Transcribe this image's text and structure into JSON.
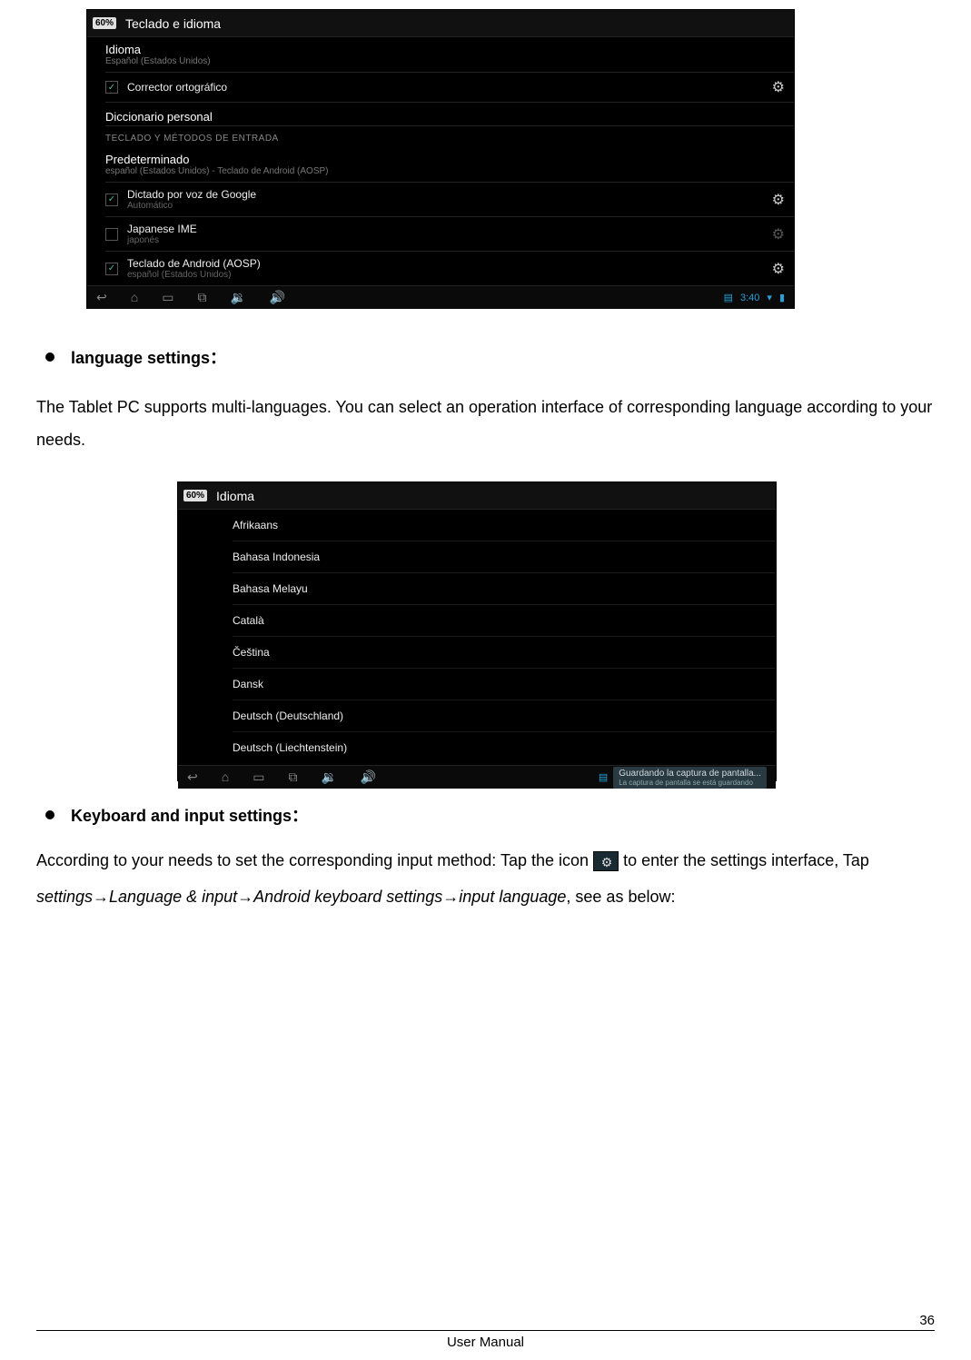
{
  "screenshot1": {
    "battery": "60%",
    "title": "Teclado e idioma",
    "idioma_label": "Idioma",
    "idioma_value": "Español (Estados Unidos)",
    "corrector_label": "Corrector ortográfico",
    "dicc_personal": "Diccionario personal",
    "teclado_cat": "TECLADO Y MÉTODOS DE ENTRADA",
    "predet_label": "Predeterminado",
    "predet_value": "español (Estados Unidos) - Teclado de Android (AOSP)",
    "rows": [
      {
        "title": "Dictado por voz de Google",
        "sub": "Automático",
        "checked": true,
        "dim": false
      },
      {
        "title": "Japanese IME",
        "sub": "japonés",
        "checked": false,
        "dim": true
      },
      {
        "title": "Teclado de Android (AOSP)",
        "sub": "español (Estados Unidos)",
        "checked": true,
        "dim": false
      }
    ],
    "nav_time": "3:40"
  },
  "bullet1": "language settings：",
  "para1": "The Tablet PC supports multi-languages. You can select an operation interface of corresponding language according to your needs.",
  "screenshot2": {
    "battery": "60%",
    "title": "Idioma",
    "languages": [
      "Afrikaans",
      "Bahasa Indonesia",
      "Bahasa Melayu",
      "Català",
      "Čeština",
      "Dansk",
      "Deutsch (Deutschland)",
      "Deutsch (Liechtenstein)"
    ],
    "toast_title": "Guardando la captura de pantalla...",
    "toast_sub": "La captura de pantalla se está guardando"
  },
  "bullet2": "Keyboard and input settings：",
  "para2_a": "According to your needs to set the corresponding input method: Tap the icon ",
  "para2_b": " to enter the settings interface, Tap ",
  "para2_path": "settings→Language & input→Android keyboard settings→input language",
  "para2_c": ", see as below:",
  "footer_center": "User Manual",
  "footer_page": "36",
  "icons": {
    "sliders": "⚙",
    "check": "✓",
    "back": "↩",
    "home": "⌂",
    "recent": "▭",
    "shot": "⧉",
    "vol_down": "🔉",
    "vol_up": "🔊",
    "sd": "▤",
    "wifi": "▾",
    "batt": "▮"
  }
}
